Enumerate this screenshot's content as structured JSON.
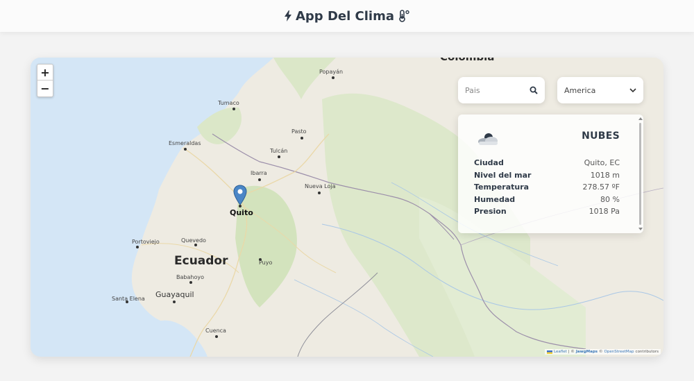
{
  "header": {
    "title": "App Del Clima",
    "bolt_icon": "bolt-icon",
    "thermometer_icon": "thermometer-icon"
  },
  "map": {
    "zoom_in_label": "+",
    "zoom_out_label": "−",
    "countries": {
      "top": "Colombia",
      "main": "Ecuador"
    },
    "cities": {
      "popayan": "Popayán",
      "tumaco": "Tumaco",
      "pasto": "Pasto",
      "esmeraldas": "Esmeraldas",
      "tulcan": "Tulcán",
      "ibarra": "Ibarra",
      "nueva_loja": "Nueva Loja",
      "quito": "Quito",
      "portoviejo": "Portoviejo",
      "quevedo": "Quevedo",
      "puyo": "Puyo",
      "babahoyo": "Babahoyo",
      "santa_elena": "Santa Elena",
      "guayaquil": "Guayaquil",
      "cuenca": "Cuenca"
    },
    "attribution": {
      "leaflet": "Leaflet",
      "sep1": "| ©",
      "jawg": "JawgMaps",
      "sep2": "©",
      "osm": "OpenStreetMap",
      "tail": "contributors"
    },
    "colors": {
      "water": "#d4e6f6",
      "land": "#eeebe2",
      "green": "#d6e6c0",
      "border": "#9c8faa"
    }
  },
  "search": {
    "placeholder": "Pais",
    "icon": "search-icon"
  },
  "region_select": {
    "selected": "America",
    "icon": "chevron-down-icon"
  },
  "weather": {
    "icon": "cloud-icon",
    "condition": "NUBES",
    "rows": [
      {
        "label": "Ciudad",
        "value": "Quito, EC"
      },
      {
        "label": "Nivel del mar",
        "value": "1018 m"
      },
      {
        "label": "Temperatura",
        "value": "278.57 ºF"
      },
      {
        "label": "Humedad",
        "value": "80 %"
      },
      {
        "label": "Presion",
        "value": "1018 Pa"
      }
    ]
  }
}
